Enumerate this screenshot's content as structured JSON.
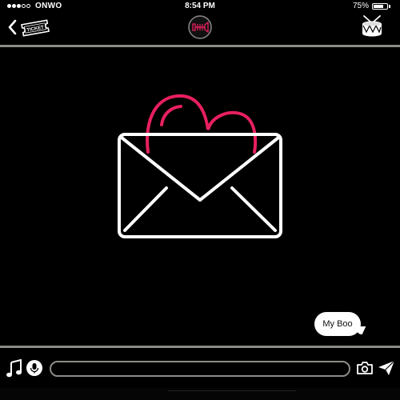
{
  "status_bar": {
    "carrier": "ONWO",
    "signal_bars": 3,
    "signal_total": 5,
    "time": "8:54 PM",
    "battery_label": "75%",
    "battery_level": 0.75
  },
  "nav": {
    "back_icon": "chevron-left-icon",
    "ticket_label": "TICKET",
    "logo_text": "DTTI",
    "drum_icon": "drum-icon"
  },
  "main": {
    "illustration": "envelope-with-heart",
    "heart_color": "#e8205f",
    "envelope_color": "#ffffff"
  },
  "messages": [
    {
      "text": "My Boo",
      "sender": "self"
    }
  ],
  "input_bar": {
    "music_icon": "music-note-icon",
    "mic_icon": "microphone-icon",
    "message_placeholder": "",
    "camera_icon": "camera-icon",
    "send_icon": "send-icon"
  },
  "colors": {
    "background": "#000000",
    "divider": "#8d8b86",
    "accent": "#e8205f",
    "bubble": "#ffffff"
  }
}
